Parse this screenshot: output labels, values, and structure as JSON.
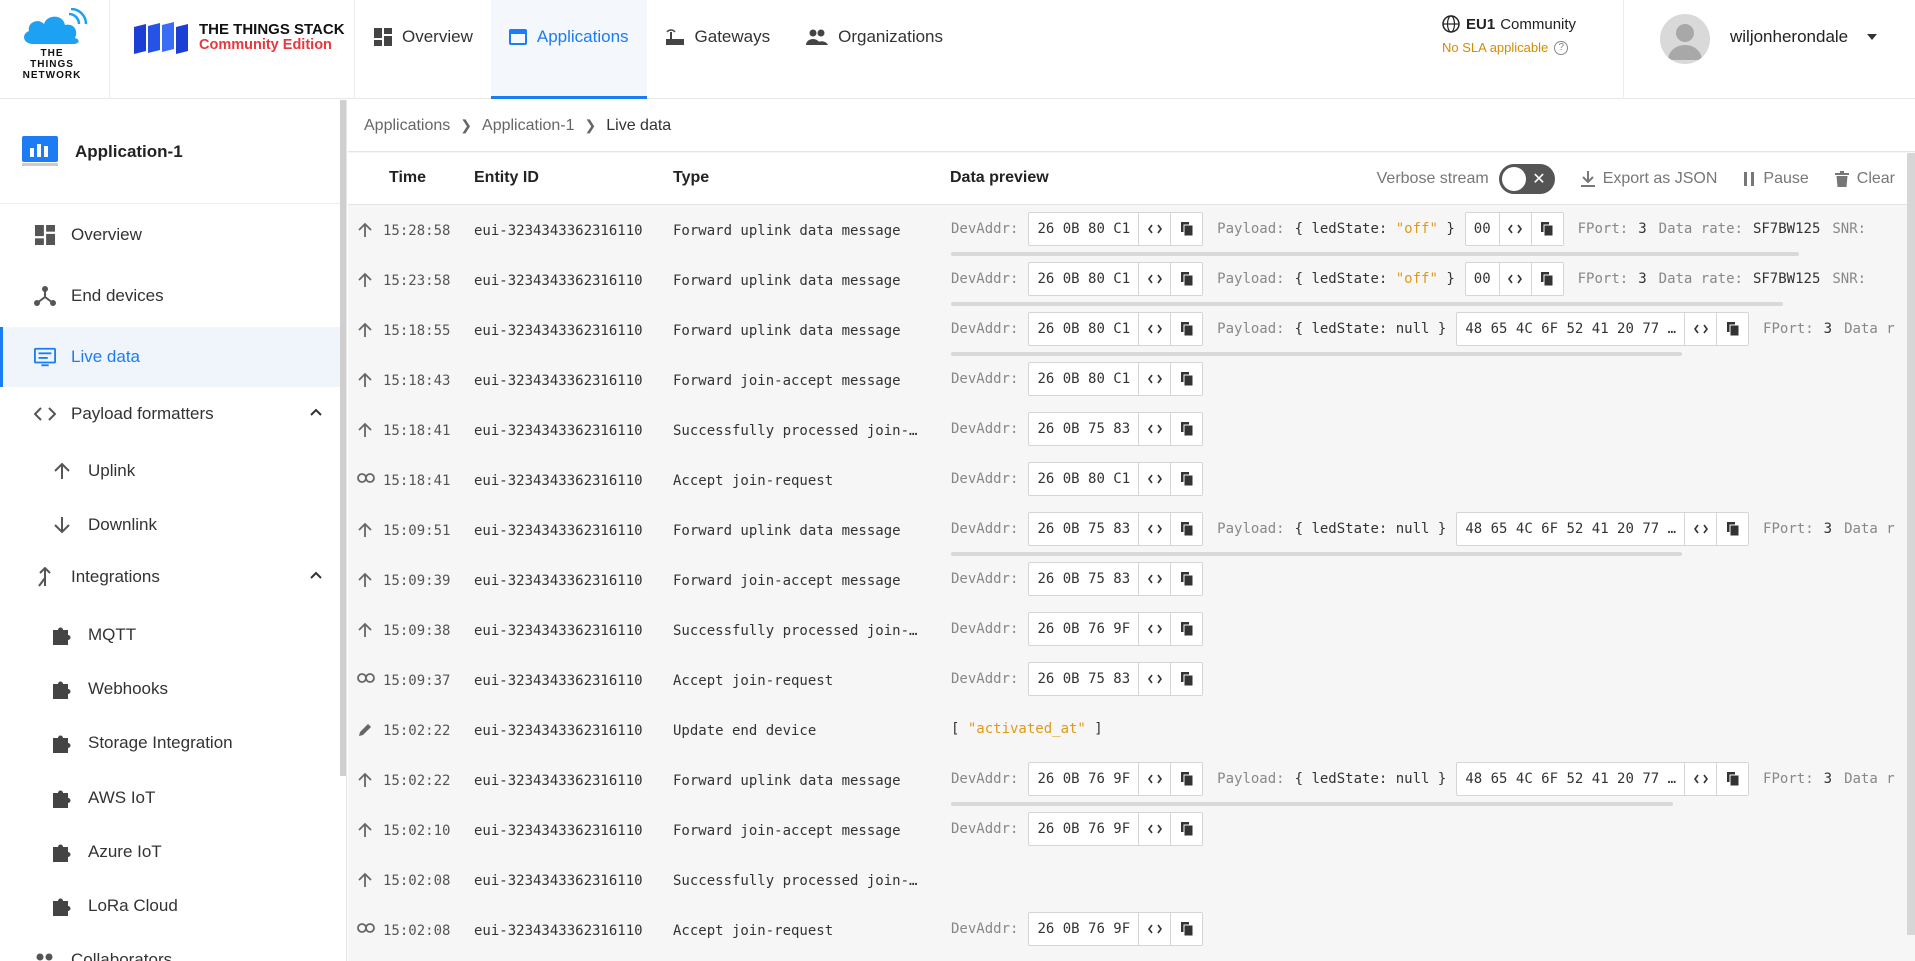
{
  "header": {
    "ttn_logo_text": "THE THINGS NETWORK",
    "stack_title": "THE THINGS STACK",
    "stack_edition": "Community Edition",
    "nav": [
      {
        "label": "Overview",
        "icon": "dashboard-icon"
      },
      {
        "label": "Applications",
        "icon": "application-icon",
        "active": true
      },
      {
        "label": "Gateways",
        "icon": "gateway-icon"
      },
      {
        "label": "Organizations",
        "icon": "people-icon"
      }
    ],
    "cluster": {
      "region": "EU1",
      "tier": "Community",
      "sla": "No SLA applicable"
    },
    "user": {
      "name": "wiljonherondale"
    }
  },
  "sidebar": {
    "app_name": "Application-1",
    "items": [
      {
        "label": "Overview",
        "icon": "dashboard-icon"
      },
      {
        "label": "End devices",
        "icon": "devices-icon"
      },
      {
        "label": "Live data",
        "icon": "monitor-icon",
        "active": true
      },
      {
        "label": "Payload formatters",
        "icon": "code-icon",
        "expanded": true
      },
      {
        "label": "Uplink",
        "icon": "arrow-up-icon"
      },
      {
        "label": "Downlink",
        "icon": "arrow-down-icon"
      },
      {
        "label": "Integrations",
        "icon": "integration-icon",
        "expanded": true
      },
      {
        "label": "MQTT",
        "icon": "puzzle-icon"
      },
      {
        "label": "Webhooks",
        "icon": "puzzle-icon"
      },
      {
        "label": "Storage Integration",
        "icon": "puzzle-icon"
      },
      {
        "label": "AWS IoT",
        "icon": "puzzle-icon"
      },
      {
        "label": "Azure IoT",
        "icon": "puzzle-icon"
      },
      {
        "label": "LoRa Cloud",
        "icon": "puzzle-icon"
      },
      {
        "label": "Collaborators",
        "icon": "collaborators-icon"
      }
    ]
  },
  "breadcrumbs": [
    "Applications",
    "Application-1",
    "Live data"
  ],
  "table": {
    "headers": {
      "time": "Time",
      "entity": "Entity ID",
      "type": "Type",
      "preview": "Data preview"
    },
    "controls": {
      "verbose": "Verbose stream",
      "export": "Export as JSON",
      "pause": "Pause",
      "clear": "Clear"
    },
    "labels": {
      "devaddr": "DevAddr:",
      "payload": "Payload:",
      "fport": "FPort:",
      "datarate": "Data rate:",
      "snr": "SNR:"
    },
    "rows": [
      {
        "icon": "up",
        "time": "15:28:58",
        "entity": "eui-3234343362316110",
        "type": "Forward uplink data message",
        "devaddr": "26 0B 80 C1",
        "payload_key": "ledState",
        "payload_val": "\"off\"",
        "payload_hex": "00",
        "fport": "3",
        "datarate": "SF7BW125"
      },
      {
        "icon": "up",
        "time": "15:23:58",
        "entity": "eui-3234343362316110",
        "type": "Forward uplink data message",
        "devaddr": "26 0B 80 C1",
        "payload_key": "ledState",
        "payload_val": "\"off\"",
        "payload_hex": "00",
        "fport": "3",
        "datarate": "SF7BW125"
      },
      {
        "icon": "up",
        "time": "15:18:55",
        "entity": "eui-3234343362316110",
        "type": "Forward uplink data message",
        "devaddr": "26 0B 80 C1",
        "payload_key": "ledState",
        "payload_val": "null",
        "payload_hex": "48 65 4C 6F 52 41 20 77 …",
        "fport": "3",
        "datarate": "Data r"
      },
      {
        "icon": "up",
        "time": "15:18:43",
        "entity": "eui-3234343362316110",
        "type": "Forward join-accept message",
        "devaddr": "26 0B 80 C1"
      },
      {
        "icon": "up",
        "time": "15:18:41",
        "entity": "eui-3234343362316110",
        "type": "Successfully processed join-…",
        "devaddr": "26 0B 75 83"
      },
      {
        "icon": "link",
        "time": "15:18:41",
        "entity": "eui-3234343362316110",
        "type": "Accept join-request",
        "devaddr": "26 0B 80 C1"
      },
      {
        "icon": "up",
        "time": "15:09:51",
        "entity": "eui-3234343362316110",
        "type": "Forward uplink data message",
        "devaddr": "26 0B 75 83",
        "payload_key": "ledState",
        "payload_val": "null",
        "payload_hex": "48 65 4C 6F 52 41 20 77 …",
        "fport": "3",
        "datarate": "Data r"
      },
      {
        "icon": "up",
        "time": "15:09:39",
        "entity": "eui-3234343362316110",
        "type": "Forward join-accept message",
        "devaddr": "26 0B 75 83"
      },
      {
        "icon": "up",
        "time": "15:09:38",
        "entity": "eui-3234343362316110",
        "type": "Successfully processed join-…",
        "devaddr": "26 0B 76 9F"
      },
      {
        "icon": "link",
        "time": "15:09:37",
        "entity": "eui-3234343362316110",
        "type": "Accept join-request",
        "devaddr": "26 0B 75 83"
      },
      {
        "icon": "edit",
        "time": "15:02:22",
        "entity": "eui-3234343362316110",
        "type": "Update end device",
        "field": "\"activated_at\""
      },
      {
        "icon": "up",
        "time": "15:02:22",
        "entity": "eui-3234343362316110",
        "type": "Forward uplink data message",
        "devaddr": "26 0B 76 9F",
        "payload_key": "ledState",
        "payload_val": "null",
        "payload_hex": "48 65 4C 6F 52 41 20 77 …",
        "fport": "3",
        "datarate": "Data r"
      },
      {
        "icon": "up",
        "time": "15:02:10",
        "entity": "eui-3234343362316110",
        "type": "Forward join-accept message",
        "devaddr": "26 0B 76 9F"
      },
      {
        "icon": "up",
        "time": "15:02:08",
        "entity": "eui-3234343362316110",
        "type": "Successfully processed join-…"
      },
      {
        "icon": "link",
        "time": "15:02:08",
        "entity": "eui-3234343362316110",
        "type": "Accept join-request",
        "devaddr": "26 0B 76 9F"
      }
    ]
  },
  "colors": {
    "accent": "#1c7cf3",
    "warning": "#d68a00",
    "string": "#e09a1a",
    "brand_red": "#e8383d"
  }
}
